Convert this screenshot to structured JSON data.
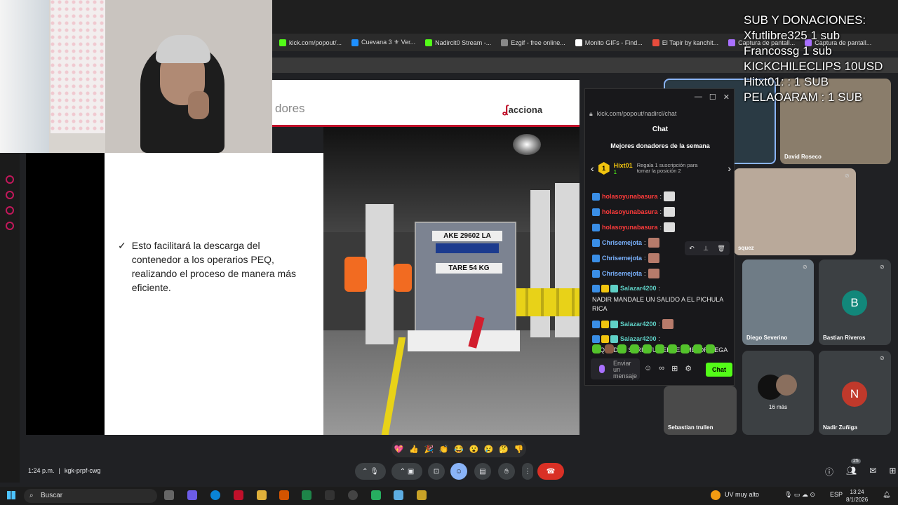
{
  "bookmarks": [
    {
      "label": "kick.com/popout/...",
      "color": "#53fc18"
    },
    {
      "label": "Cuevana 3 ⚜ Ver...",
      "color": "#1e90ff"
    },
    {
      "label": "Nadircit0 Stream -...",
      "color": "#53fc18"
    },
    {
      "label": "Ezgif - free online...",
      "color": "#888888"
    },
    {
      "label": "Monito GIFs - Find...",
      "color": "#ffffff"
    },
    {
      "label": "El Tapir by kanchit...",
      "color": "#e74c3c"
    },
    {
      "label": "Captura de pantall...",
      "color": "#a970ff"
    },
    {
      "label": "Captura de pantall...",
      "color": "#a970ff"
    }
  ],
  "slide": {
    "title": "dores",
    "logo": "acciona",
    "bullet": "Esto facilitará  la descarga del contenedor a los operarios PEQ, realizando el proceso de manera más eficiente.",
    "photo_label_1": "AKE 29602 LA",
    "photo_label_2": "TARE 54 KG"
  },
  "chat": {
    "url": "kick.com/popout/nadircl/chat",
    "header": "Chat",
    "top_donors_title": "Mejores donadores de la semana",
    "donor_rank": "1",
    "donor_name": "Hixt01",
    "donor_subs": "1",
    "gift_hint": "Regala 1 suscripción para tomar la posición 2",
    "messages": [
      {
        "user": "holasoyunabasura",
        "text": "",
        "color": "red"
      },
      {
        "user": "holasoyunabasura",
        "text": "",
        "color": "red"
      },
      {
        "user": "holasoyunabasura",
        "text": "",
        "color": "red"
      },
      {
        "user": "Chrisemejota",
        "text": "",
        "color": "blue"
      },
      {
        "user": "Chrisemejota",
        "text": "",
        "color": "blue"
      },
      {
        "user": "Chrisemejota",
        "text": "",
        "color": "blue"
      },
      {
        "user": "Salazar4200",
        "text": "NADIR MANDALE UN SALIDO A EL PICHULA RICA",
        "color": "teal"
      },
      {
        "user": "Salazar4200",
        "text": "",
        "color": "teal"
      },
      {
        "user": "Salazar4200",
        "text": "SI QUEDAS SERIA TU TERCER MEJOR PEGA",
        "color": "teal"
      }
    ],
    "input_placeholder": "Enviar un mensaje",
    "send_label": "Chat"
  },
  "participants": [
    {
      "name": "David Roseco"
    },
    {
      "name": "squez"
    },
    {
      "name": "Diego Severino"
    },
    {
      "name": "Bastian Riveros",
      "initial": "B",
      "color": "#12877a"
    },
    {
      "name": "16 más"
    },
    {
      "name": "Sebastian trullen"
    },
    {
      "name": "Nadir Zuñiga",
      "initial": "N",
      "color": "#c0392b"
    }
  ],
  "overlay": {
    "lines": [
      "SUB Y DONACIONES:",
      "Xfutlibre325 1 sub",
      "Francossg 1 sub",
      "KICKCHILECLIPS 10USD",
      "Hitxt01: : 1 SUB",
      "PELAOARAM : 1 SUB"
    ]
  },
  "reactions": [
    "💖",
    "👍",
    "🎉",
    "👏",
    "😂",
    "😮",
    "😢",
    "🤔",
    "👎"
  ],
  "meet": {
    "time": "1:24 p.m.",
    "code": "kgk-prpf-cwg",
    "people_count": "25"
  },
  "taskbar": {
    "search_placeholder": "Buscar",
    "weather": "UV muy alto",
    "lang": "ESP",
    "time": "13:24",
    "date": "8/1/2026"
  }
}
